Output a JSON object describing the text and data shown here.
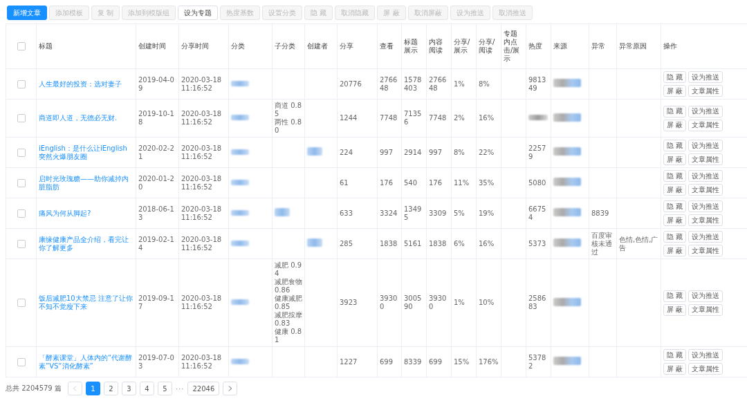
{
  "toolbar": [
    {
      "label": "新增文章",
      "primary": true,
      "disabled": false
    },
    {
      "label": "添加模板",
      "primary": false,
      "disabled": true
    },
    {
      "label": "复 制",
      "primary": false,
      "disabled": true
    },
    {
      "label": "添加到模版组",
      "primary": false,
      "disabled": true
    },
    {
      "label": "设为专题",
      "primary": false,
      "disabled": false
    },
    {
      "label": "热度基数",
      "primary": false,
      "disabled": true
    },
    {
      "label": "设置分类",
      "primary": false,
      "disabled": true
    },
    {
      "label": "隐 藏",
      "primary": false,
      "disabled": true
    },
    {
      "label": "取消隐藏",
      "primary": false,
      "disabled": true
    },
    {
      "label": "屏 蔽",
      "primary": false,
      "disabled": true
    },
    {
      "label": "取消屏蔽",
      "primary": false,
      "disabled": true
    },
    {
      "label": "设为推送",
      "primary": false,
      "disabled": true
    },
    {
      "label": "取消推送",
      "primary": false,
      "disabled": true
    }
  ],
  "table": {
    "select_all": {
      "checked": false
    },
    "columns": [
      "标题",
      "创建时间",
      "分享时间",
      "分类",
      "子分类",
      "创建者",
      "分享",
      "查看",
      "标题展示",
      "内容阅读",
      "分享/展示",
      "分享/阅读",
      "专题内点击/展示",
      "热度",
      "来源",
      "异常",
      "异常原因",
      "操作"
    ],
    "rows": [
      {
        "checked": false,
        "title": "人生最好的投资：选对妻子",
        "created": "2019-04-09",
        "shared": "2020-03-18 11:16:52",
        "category_redacted": true,
        "subcategories": [],
        "shares": "20776",
        "views": "276648",
        "title_impressions": "1578403",
        "content_reads": "276648",
        "share_per_impression": "1%",
        "share_per_read": "8%",
        "heat": "981349",
        "source_redacted": true,
        "actions": [
          "隐 藏",
          "设为推送",
          "屏 蔽",
          "文章属性"
        ]
      },
      {
        "checked": false,
        "title": "商道即人道，无德必无财.",
        "created": "2019-10-18",
        "shared": "2020-03-18 11:16:52",
        "category_redacted": true,
        "subcategories": [
          "商道 0.85",
          "两性 0.80"
        ],
        "shares": "1244",
        "views": "7748",
        "title_impressions": "71356",
        "content_reads": "7748",
        "share_per_impression": "2%",
        "share_per_read": "16%",
        "heat_redacted": true,
        "source_redacted": true,
        "actions": [
          "隐 藏",
          "设为推送",
          "屏 蔽",
          "文章属性"
        ]
      },
      {
        "checked": false,
        "title": "iEnglish：是什么让iEnglish突然火爆朋友圈",
        "created": "2020-02-21",
        "shared": "2020-03-18 11:16:52",
        "category_redacted": true,
        "subcategories": [],
        "creator_redacted": true,
        "shares": "224",
        "views": "997",
        "title_impressions": "2914",
        "content_reads": "997",
        "share_per_impression": "8%",
        "share_per_read": "22%",
        "heat": "22579",
        "source_redacted": true,
        "actions": [
          "隐 藏",
          "设为推送",
          "屏 蔽",
          "文章属性"
        ]
      },
      {
        "checked": false,
        "title": "启时光玫瑰糖——助你减掉内脏脂肪",
        "created": "2020-01-20",
        "shared": "2020-03-18 11:16:52",
        "category_redacted": true,
        "subcategories": [],
        "shares": "61",
        "views": "176",
        "title_impressions": "540",
        "content_reads": "176",
        "share_per_impression": "11%",
        "share_per_read": "35%",
        "heat": "5080",
        "source_redacted": true,
        "actions": [
          "隐 藏",
          "设为推送",
          "屏 蔽",
          "文章属性"
        ]
      },
      {
        "checked": false,
        "title": "痛风为何从脚起?",
        "created": "2018-06-13",
        "shared": "2020-03-18 11:16:52",
        "category_redacted": true,
        "subcategories": [],
        "subcategory_redacted": true,
        "shares": "633",
        "views": "3324",
        "title_impressions": "13495",
        "content_reads": "3309",
        "share_per_impression": "5%",
        "share_per_read": "19%",
        "heat": "66754",
        "source_redacted": true,
        "abnormal": "8839",
        "actions": [
          "隐 藏",
          "设为推送",
          "屏 蔽",
          "文章属性"
        ]
      },
      {
        "checked": false,
        "title": "康缘健康产品全介绍，看完让你了解更多",
        "created": "2019-02-14",
        "shared": "2020-03-18 11:16:52",
        "category_redacted": true,
        "subcategories": [],
        "creator_redacted": true,
        "shares": "285",
        "views": "1838",
        "title_impressions": "5161",
        "content_reads": "1838",
        "share_per_impression": "6%",
        "share_per_read": "16%",
        "heat": "5373",
        "source_redacted": true,
        "abnormal": "百度审核未通过",
        "abnormal_reason": "色情,色情,广告",
        "actions": [
          "隐 藏",
          "设为推送",
          "屏 蔽",
          "文章属性"
        ]
      },
      {
        "checked": false,
        "title": "饭后减肥10大禁忌 注意了让你不知不觉瘦下来",
        "created": "2019-09-17",
        "shared": "2020-03-18 11:16:52",
        "category_redacted": true,
        "subcategories": [
          "减肥 0.94",
          "减肥食物 0.86",
          "健康减肥 0.85",
          "减肥按摩 0.83",
          "健康 0.81"
        ],
        "shares": "3923",
        "views": "39300",
        "title_impressions": "300590",
        "content_reads": "39300",
        "share_per_impression": "1%",
        "share_per_read": "10%",
        "heat": "258683",
        "source_redacted": true,
        "actions": [
          "隐 藏",
          "设为推送",
          "屏 蔽",
          "文章属性"
        ]
      },
      {
        "checked": false,
        "title": "「酵素课堂」人体内的“代谢酵素”VS“消化酵素”",
        "created": "2019-07-03",
        "shared": "2020-03-18 11:16:52",
        "category_redacted": true,
        "subcategories": [],
        "shares": "1227",
        "views": "699",
        "title_impressions": "8339",
        "content_reads": "699",
        "share_per_impression": "15%",
        "share_per_read": "176%",
        "heat": "53782",
        "source_redacted": true,
        "actions": [
          "隐 藏",
          "设为推送",
          "屏 蔽",
          "文章属性"
        ]
      }
    ]
  },
  "pagination": {
    "total": "总共 2204579 篇",
    "prev_disabled": true,
    "pages": [
      {
        "label": "1",
        "selected": true
      },
      {
        "label": "2",
        "selected": false
      },
      {
        "label": "3",
        "selected": false
      },
      {
        "label": "4",
        "selected": false
      },
      {
        "label": "5",
        "selected": false
      }
    ],
    "ellipsis": "···",
    "last": "22046"
  }
}
